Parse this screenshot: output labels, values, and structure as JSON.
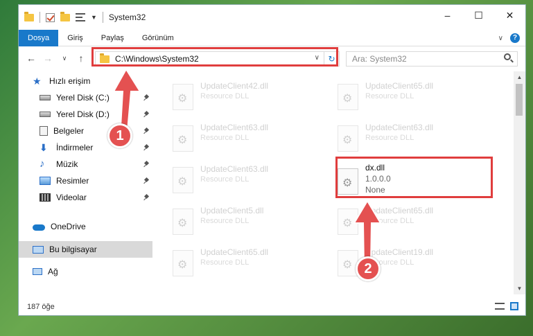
{
  "window": {
    "title": "System32",
    "controls": {
      "minimize": "–",
      "maximize": "☐",
      "close": "✕"
    }
  },
  "ribbon": {
    "tabs": [
      {
        "label": "Dosya",
        "active": true
      },
      {
        "label": "Giriş"
      },
      {
        "label": "Paylaş"
      },
      {
        "label": "Görünüm"
      }
    ],
    "help": "?"
  },
  "nav": {
    "address": "C:\\Windows\\System32",
    "search_placeholder": "Ara: System32"
  },
  "sidebar": {
    "items": [
      {
        "label": "Hızlı erişim",
        "icon": "star-icon"
      },
      {
        "label": "Yerel Disk (C:)",
        "icon": "disk-icon",
        "pinned": true
      },
      {
        "label": "Yerel Disk (D:)",
        "icon": "disk-icon",
        "pinned": true
      },
      {
        "label": "Belgeler",
        "icon": "document-icon",
        "pinned": true
      },
      {
        "label": "İndirmeler",
        "icon": "download-icon",
        "pinned": true
      },
      {
        "label": "Müzik",
        "icon": "music-icon",
        "pinned": true
      },
      {
        "label": "Resimler",
        "icon": "pictures-icon",
        "pinned": true
      },
      {
        "label": "Videolar",
        "icon": "videos-icon",
        "pinned": true
      },
      {
        "label": "OneDrive",
        "icon": "cloud-icon"
      },
      {
        "label": "Bu bilgisayar",
        "icon": "computer-icon",
        "selected": true
      },
      {
        "label": "Ağ",
        "icon": "network-icon"
      }
    ]
  },
  "files": [
    {
      "name": "UpdateClient42.dll",
      "sub": "Resource DLL"
    },
    {
      "name": "UpdateClient65.dll",
      "sub": "Resource DLL"
    },
    {
      "name": "UpdateClient63.dll",
      "sub": "Resource DLL"
    },
    {
      "name": "UpdateClient63.dll",
      "sub": "Resource DLL"
    },
    {
      "name": "UpdateClient63.dll",
      "sub": "Resource DLL"
    },
    {
      "name": "dx.dll",
      "sub": "1.0.0.0",
      "sub2": "None"
    },
    {
      "name": "UpdateClient5.dll",
      "sub": "Resource DLL"
    },
    {
      "name": "UpdateClient65.dll",
      "sub": "Resource DLL"
    },
    {
      "name": "UpdateClient65.dll",
      "sub": "Resource DLL"
    },
    {
      "name": "UpdateClient19.dll",
      "sub": "Resource DLL"
    }
  ],
  "status": {
    "count": "187 öğe"
  },
  "annotations": {
    "accent": "#e03d3d",
    "badges": [
      "1",
      "2"
    ]
  }
}
